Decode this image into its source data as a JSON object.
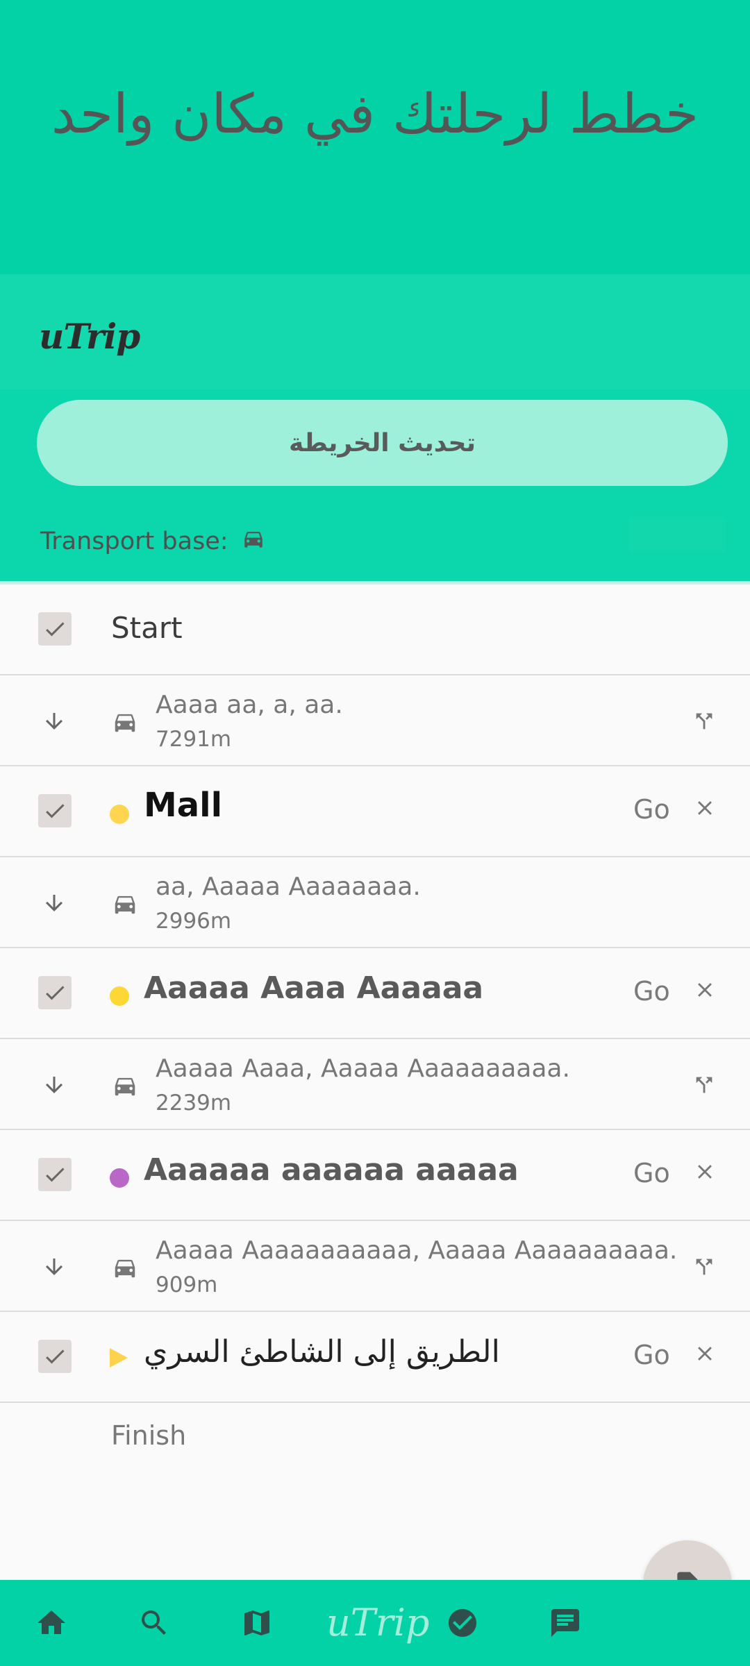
{
  "header": {
    "title": "خطط لرحلتك في مكان واحد"
  },
  "panel": {
    "brand": "uTrip",
    "refresh_button": "تحديث الخريطة",
    "transport_label": "Transport base:",
    "transport_icon": "car-icon"
  },
  "itinerary": {
    "start_label": "Start",
    "finish_label": "Finish",
    "go_label": "Go",
    "segments": [
      {
        "address": "Aaaa aa, a, aa.",
        "distance": "7291m",
        "has_fork": true
      },
      {
        "address": "aa, Aaaaa Aaaaaaaa.",
        "distance": "2996m",
        "has_fork": false
      },
      {
        "address": "Aaaaa Aaaa, Aaaaa Aaaaaaaaaa.",
        "distance": "2239m",
        "has_fork": true
      },
      {
        "address": "Aaaaa Aaaaaaaaaaa, Aaaaa Aaaaaaaaaa.",
        "distance": "909m",
        "has_fork": true
      }
    ],
    "stops": [
      {
        "name": "Mall",
        "marker": "dot",
        "color": "#ffd54f"
      },
      {
        "name": "Aaaaa Aaaa Aaaaaa",
        "marker": "dot",
        "color": "#fdd835"
      },
      {
        "name": "Aaaaaa aaaaaa aaaaa",
        "marker": "dot",
        "color": "#ba68c8"
      },
      {
        "name": "الطريق إلى الشاطئ السري",
        "marker": "triangle",
        "color": "#ffd24d"
      }
    ]
  },
  "bottom_nav": {
    "items": [
      "home-icon",
      "search-icon",
      "map-icon",
      "utrip-logo",
      "check-circle-icon",
      "chat-icon"
    ],
    "logo_text": "uTrip"
  },
  "fab": {
    "icon": "contact-document-icon"
  },
  "colors": {
    "primary": "#03d1a6",
    "button": "#9ef0da"
  }
}
